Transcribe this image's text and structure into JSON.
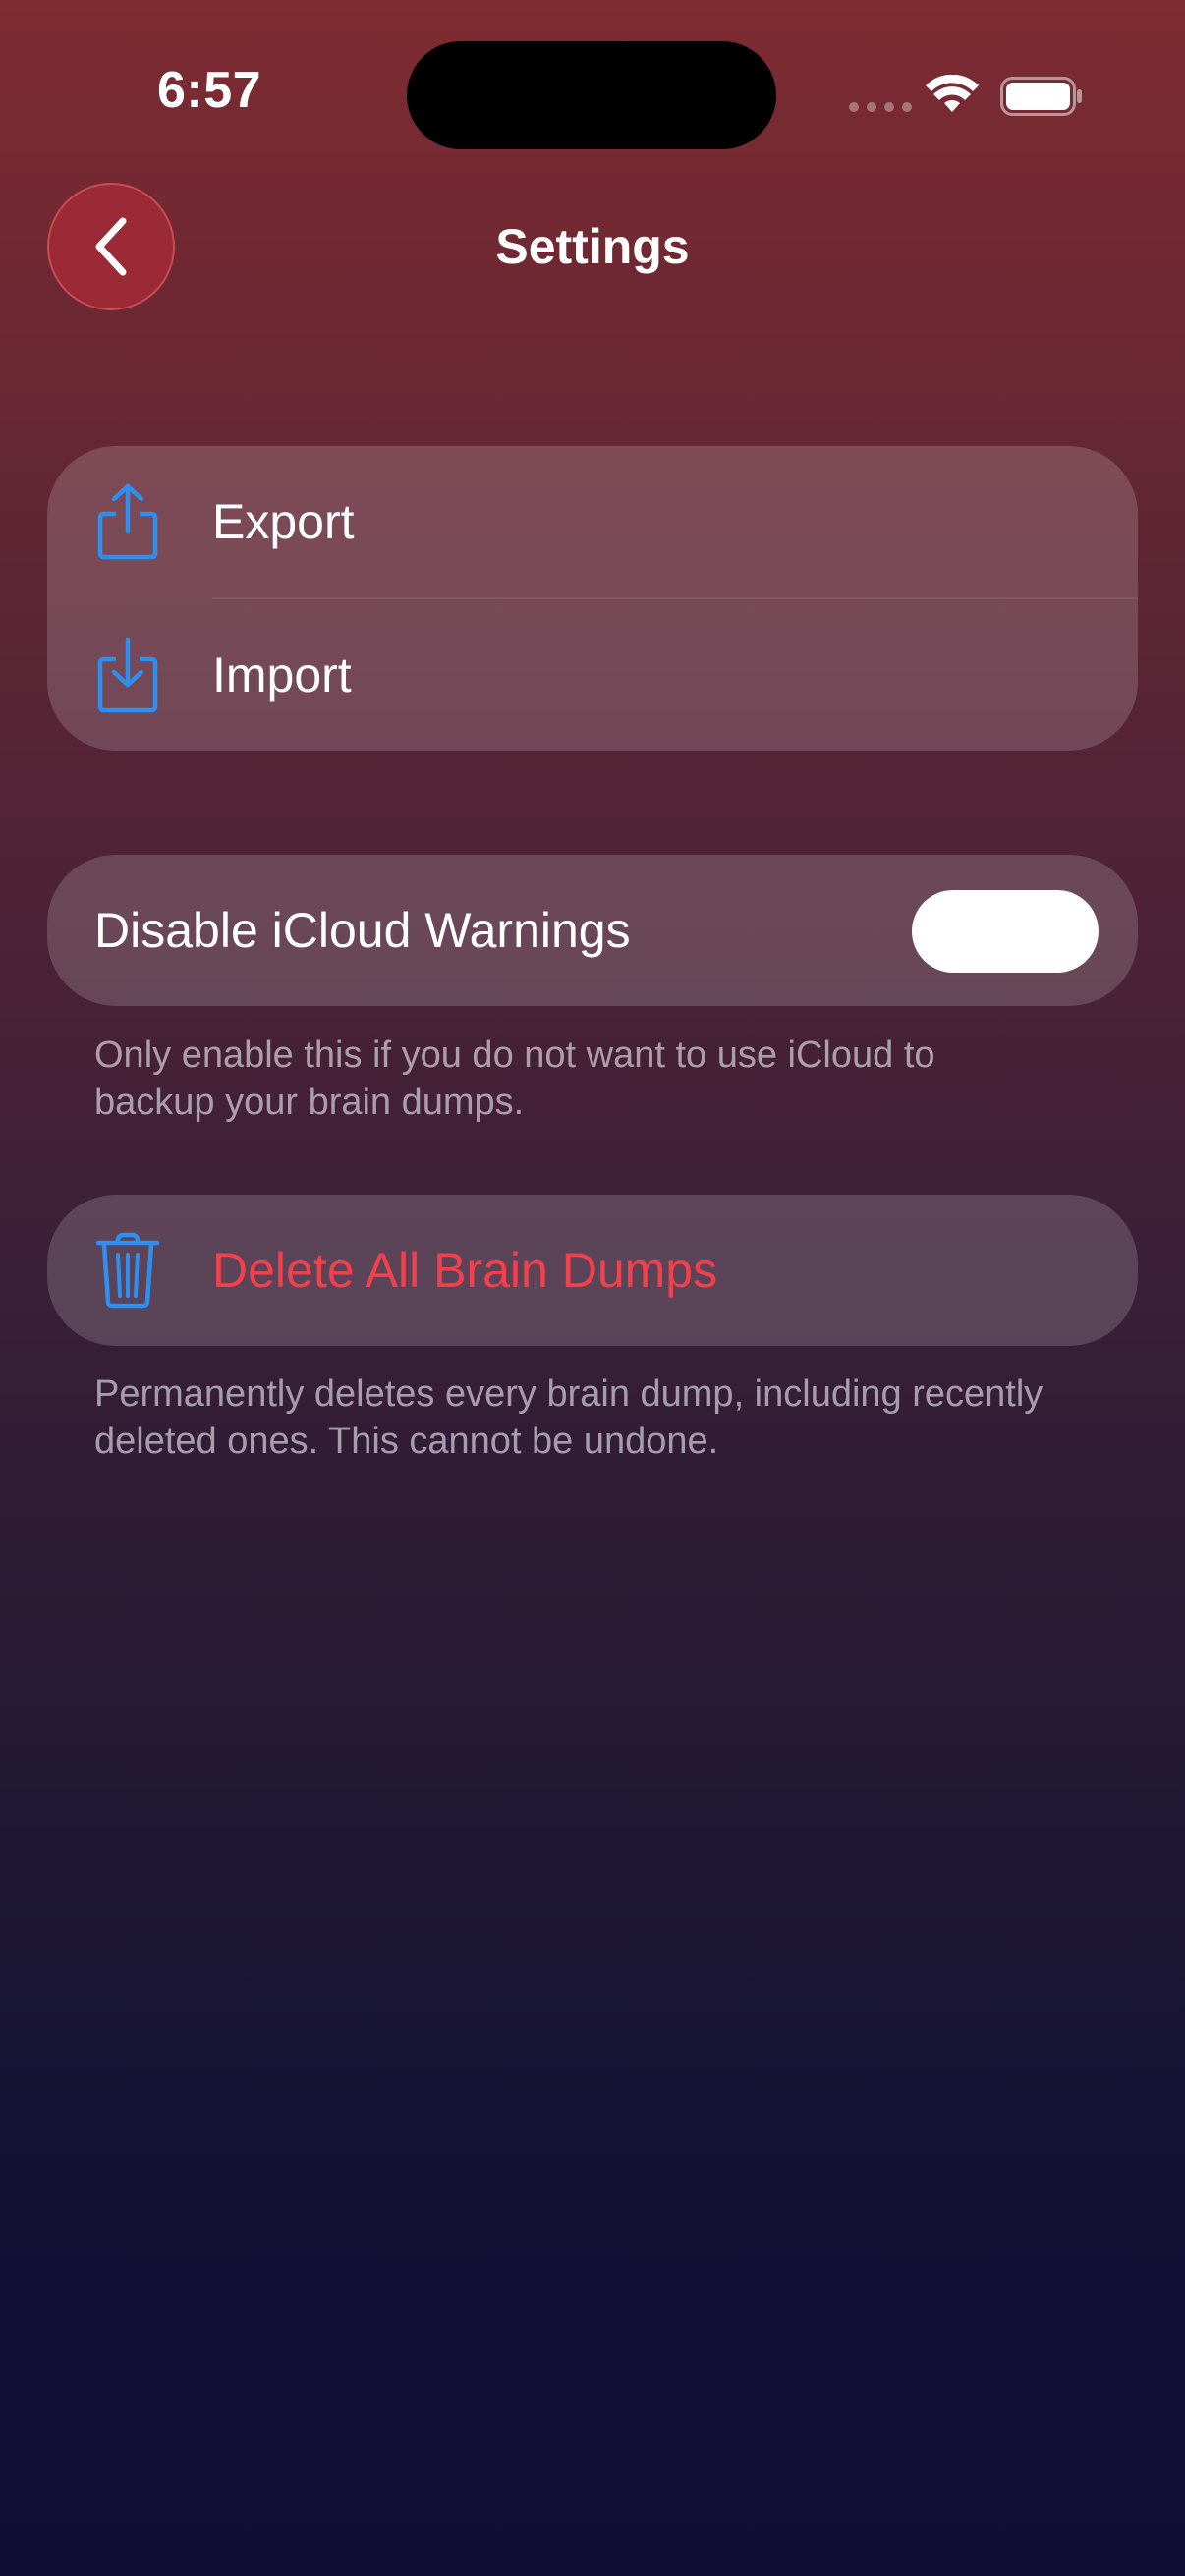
{
  "status_bar": {
    "time": "6:57"
  },
  "header": {
    "title": "Settings",
    "back_icon": "chevron-left-icon"
  },
  "transfer_group": {
    "items": [
      {
        "label": "Export",
        "icon": "share-upload-icon"
      },
      {
        "label": "Import",
        "icon": "download-tray-icon"
      }
    ]
  },
  "icloud": {
    "label": "Disable iCloud Warnings",
    "toggle_on": false,
    "footnote": "Only enable this if you do not want to use iCloud to backup your brain dumps."
  },
  "delete": {
    "label": "Delete All Brain Dumps",
    "icon": "trash-icon",
    "footnote": "Permanently deletes every brain dump, including recently deleted ones. This cannot be undone."
  },
  "colors": {
    "accent_blue": "#2f8ff0",
    "destructive_red": "#f2404c",
    "back_button": "#9b2a36"
  }
}
